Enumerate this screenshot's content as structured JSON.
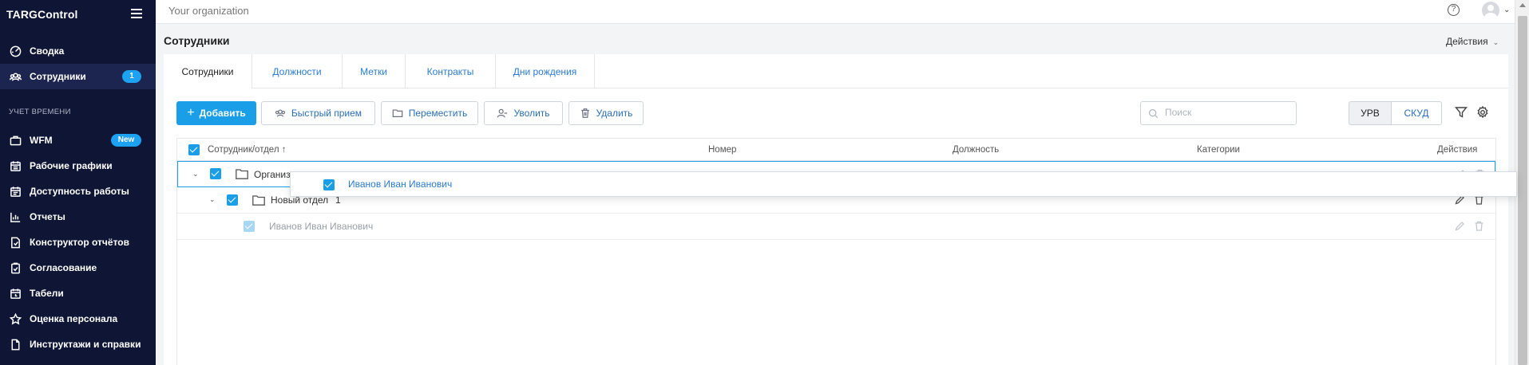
{
  "app": {
    "brand": "TARGControl",
    "organization": "Your organization"
  },
  "sidebar": {
    "items_top": [
      {
        "label": "Сводка",
        "icon": "dashboard-icon"
      },
      {
        "label": "Сотрудники",
        "icon": "users-icon",
        "badge": "1",
        "active": true
      }
    ],
    "section_label": "УЧЕТ ВРЕМЕНИ",
    "items": [
      {
        "label": "WFM",
        "icon": "briefcase-icon",
        "badge": "New"
      },
      {
        "label": "Рабочие графики",
        "icon": "calendar-icon"
      },
      {
        "label": "Доступность работы",
        "icon": "calendar-check-icon"
      },
      {
        "label": "Отчеты",
        "icon": "chart-icon"
      },
      {
        "label": "Конструктор отчётов",
        "icon": "report-builder-icon"
      },
      {
        "label": "Согласование",
        "icon": "approval-icon"
      },
      {
        "label": "Табели",
        "icon": "timesheet-icon"
      },
      {
        "label": "Оценка персонала",
        "icon": "star-icon"
      },
      {
        "label": "Инструктажи и справки",
        "icon": "document-icon"
      }
    ]
  },
  "header": {
    "title": "Сотрудники",
    "actions_label": "Действия"
  },
  "tabs": [
    "Сотрудники",
    "Должности",
    "Метки",
    "Контракты",
    "Дни рождения"
  ],
  "toolbar": {
    "add": "Добавить",
    "quick_hire": "Быстрый прием",
    "move": "Переместить",
    "dismiss": "Уволить",
    "delete": "Удалить",
    "search_placeholder": "Поиск",
    "seg_urv": "УРВ",
    "seg_skud": "СКУД"
  },
  "table": {
    "columns": [
      "Сотрудник/отдел ↑",
      "Номер",
      "Должность",
      "Категории",
      "Действия"
    ],
    "rows": [
      {
        "label": "Организация",
        "type": "root"
      },
      {
        "label": "Новый отдел",
        "count": "1",
        "type": "department"
      },
      {
        "label": "Иванов Иван Иванович",
        "type": "employee"
      }
    ]
  },
  "drag_ghost": {
    "label": "Иванов Иван Иванович"
  }
}
